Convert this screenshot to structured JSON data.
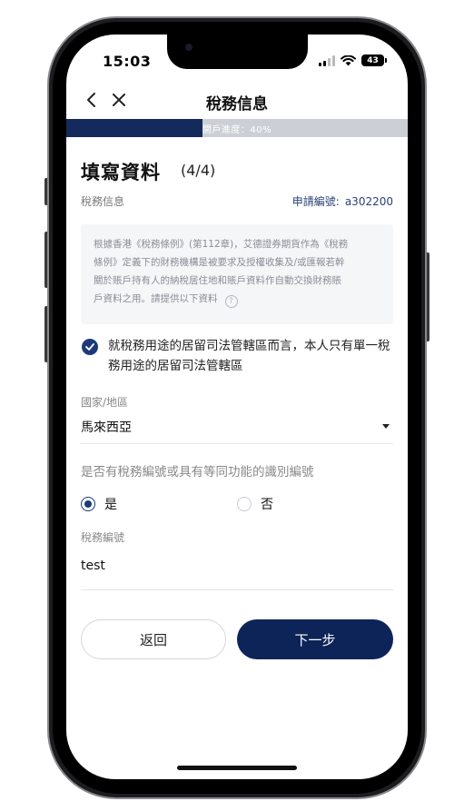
{
  "status_bar": {
    "time": "15:03",
    "battery": "43"
  },
  "nav": {
    "title": "稅務信息"
  },
  "progress": {
    "text": "開戶進度：40%",
    "value": 0.4
  },
  "page": {
    "title": "填寫資料",
    "step": "(4/4)",
    "section_label": "稅務信息",
    "app_no_label": "申請編號:",
    "app_no_value": "a302200"
  },
  "notice": {
    "lines": [
      "根據香港《稅務條例》(第112章)，艾德證券期貨作為《稅務",
      "條例》定義下的財務機構是被要求及授權收集及/或匯報若幹",
      "關於賬戶持有人的納稅居住地和賬戶資料作自動交換財務賬",
      "戶資料之用。請提供以下資料"
    ],
    "help_icon": "?"
  },
  "declaration": {
    "text": "就稅務用途的居留司法管轄區而言，本人只有單一稅務用途的居留司法管轄區",
    "checked": true
  },
  "country": {
    "label": "國家/地區",
    "value": "馬來西亞"
  },
  "has_tax_id": {
    "question": "是否有稅務編號或具有等同功能的識別編號",
    "yes_label": "是",
    "no_label": "否",
    "selected": "yes"
  },
  "tax_id": {
    "label": "稅務編號",
    "value": "test"
  },
  "buttons": {
    "back": "返回",
    "next": "下一步"
  },
  "colors": {
    "accent": "#0d2459",
    "progress_track": "#ccd0d6",
    "link": "#2a3f75"
  }
}
